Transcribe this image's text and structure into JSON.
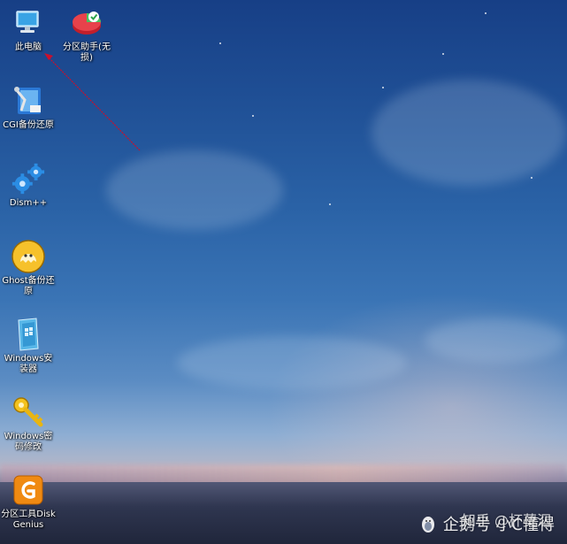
{
  "desktop": {
    "icons": [
      {
        "label": "此电脑",
        "icon": "computer-icon"
      },
      {
        "label": "分区助手(无损)",
        "icon": "partition-assistant-icon"
      },
      {
        "label": "CGI备份还原",
        "icon": "cgi-backup-icon"
      },
      {
        "label": "Dism++",
        "icon": "gears-icon"
      },
      {
        "label": "Ghost备份还原",
        "icon": "ghost-icon"
      },
      {
        "label": "Windows安装器",
        "icon": "windows-installer-icon"
      },
      {
        "label": "Windows密码修改",
        "icon": "key-icon"
      },
      {
        "label": "分区工具DiskGenius",
        "icon": "diskgenius-icon"
      }
    ]
  },
  "watermark": {
    "text": "企鹅号 小C懂得",
    "overlay": "知乎 @杯莫泅"
  },
  "colors": {
    "annotation_arrow": "#c8102e",
    "sky_top": "#173f86",
    "sky_mid": "#3a74b5"
  }
}
